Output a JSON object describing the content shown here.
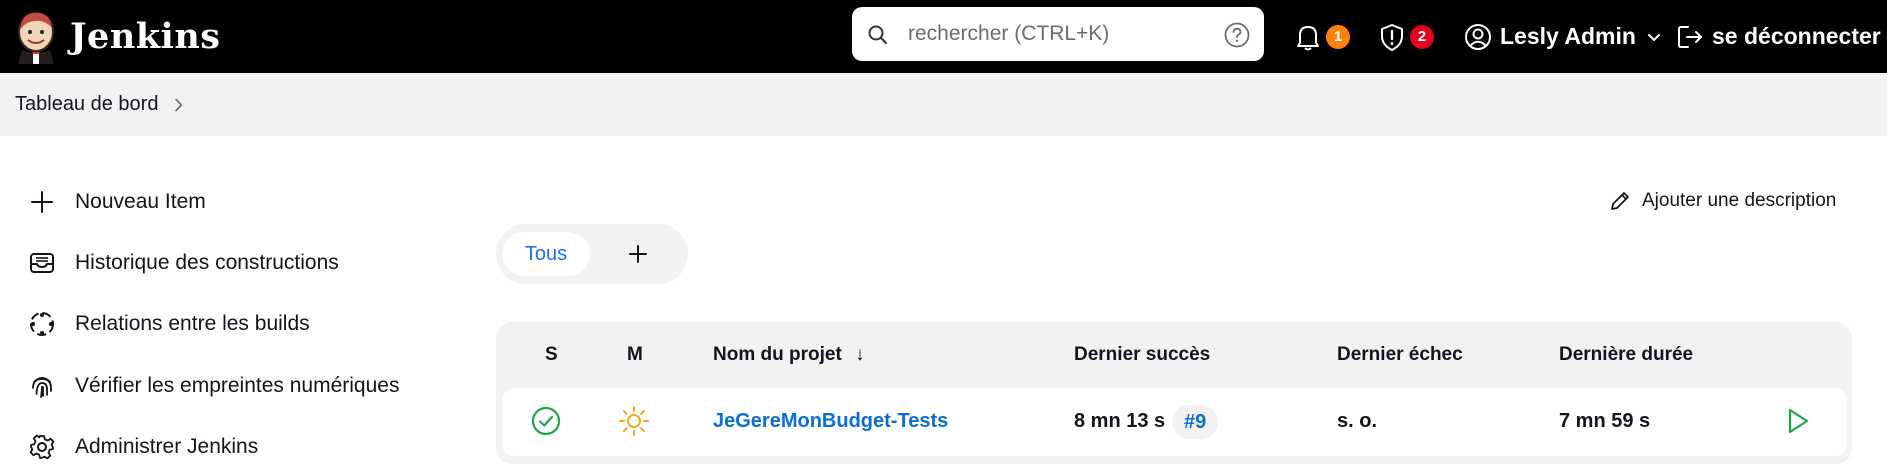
{
  "header": {
    "brand": "Jenkins",
    "search_placeholder": "rechercher (CTRL+K)",
    "notifications_count": "1",
    "security_count": "2",
    "user_name": "Lesly Admin",
    "logout_label": "se déconnecter"
  },
  "breadcrumb": {
    "items": [
      "Tableau de bord"
    ]
  },
  "sidebar": {
    "items": [
      {
        "label": "Nouveau Item",
        "icon": "plus-icon"
      },
      {
        "label": "Historique des constructions",
        "icon": "inbox-icon"
      },
      {
        "label": "Relations entre les builds",
        "icon": "relations-icon"
      },
      {
        "label": "Vérifier les empreintes numériques",
        "icon": "fingerprint-icon"
      },
      {
        "label": "Administrer Jenkins",
        "icon": "gear-icon"
      }
    ]
  },
  "main": {
    "add_description_label": "Ajouter une description",
    "tabs": [
      {
        "label": "Tous",
        "active": true
      }
    ],
    "table": {
      "headers": {
        "status": "S",
        "weather": "M",
        "name": "Nom du projet",
        "name_sort": "↓",
        "last_success": "Dernier succès",
        "last_failure": "Dernier échec",
        "last_duration": "Dernière durée"
      },
      "rows": [
        {
          "status": "success",
          "weather": "sunny",
          "name": "JeGereMonBudget-Tests",
          "last_success": "8 mn 13 s",
          "last_success_build": "#9",
          "last_failure": "s. o.",
          "last_duration": "7 mn 59 s"
        }
      ]
    }
  },
  "colors": {
    "header_bg": "#000000",
    "accent_link": "#0b6dd6",
    "badge_orange": "#fe820a",
    "badge_red": "#e6001f",
    "success_green": "#1ea64b",
    "sun_orange": "#f5a623"
  }
}
